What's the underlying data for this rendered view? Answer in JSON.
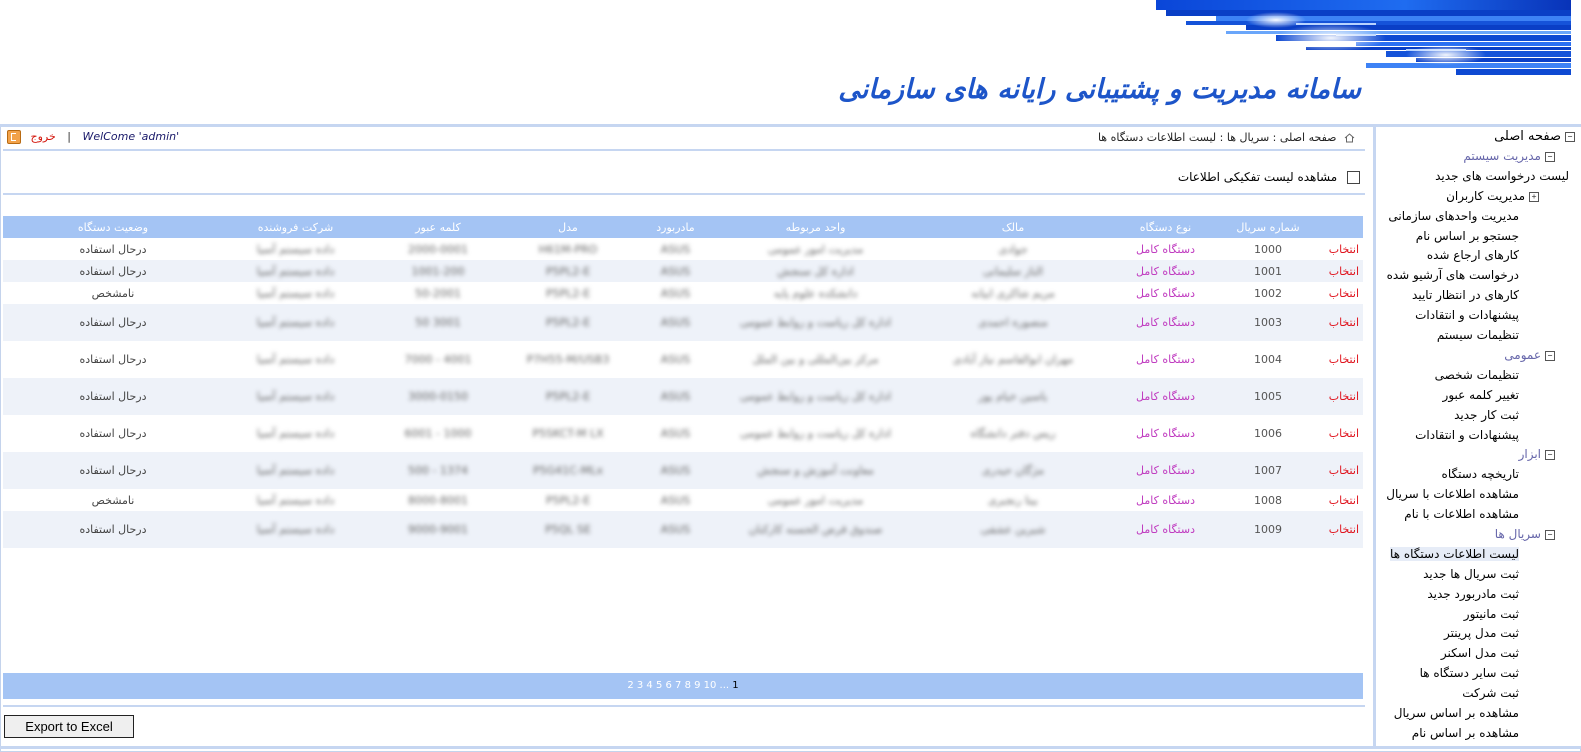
{
  "header": {
    "title": "سامانه مدیریت و پشتیبانی رایانه های سازمانی"
  },
  "topbar": {
    "breadcrumb": "صفحه اصلی : سریال ها : لیست اطلاعات دستگاه ها",
    "exit_label": "خروج",
    "separator": "|",
    "welcome": "WelCome 'admin'"
  },
  "filter": {
    "checkbox_label": "مشاهده لیست تفکیکی اطلاعات"
  },
  "table": {
    "columns": [
      "",
      "شماره سریال",
      "نوع دستگاه",
      "مالک",
      "واحد مربوطه",
      "مادربورد",
      "مدل",
      "کلمه عبور",
      "شرکت فروشنده",
      "وضعیت دستگاه"
    ],
    "rows": [
      {
        "action": "انتخاب",
        "serial": "1000",
        "type": "دستگاه کامل",
        "owner": "جوادی",
        "unit": "مدیریت امور عمومی",
        "mb": "ASUS",
        "model": "H61M-PRO",
        "password": "2000-0001",
        "vendor": "داده سیستم آسیا",
        "status": "درحال استفاده"
      },
      {
        "action": "انتخاب",
        "serial": "1001",
        "type": "دستگاه کامل",
        "owner": "الناز سلیمانی",
        "unit": "اداره کل سنجش",
        "mb": "ASUS",
        "model": "P5PL2-E",
        "password": "1001-200",
        "vendor": "داده سیستم آسیا",
        "status": "درحال استفاده"
      },
      {
        "action": "انتخاب",
        "serial": "1002",
        "type": "دستگاه کامل",
        "owner": "مریم شاکری ابیانه",
        "unit": "دانشکده علوم پایه",
        "mb": "ASUS",
        "model": "P5PL2-E",
        "password": "50-2001",
        "vendor": "داده سیستم آسیا",
        "status": "نامشخص"
      },
      {
        "action": "انتخاب",
        "serial": "1003",
        "type": "دستگاه کامل",
        "owner": "منصوره احمدی",
        "unit": "اداره کل ریاست و روابط عمومی",
        "mb": "ASUS",
        "model": "P5PL2-E",
        "password": "3001 50",
        "vendor": "داده سیستم آسیا",
        "status": "درحال استفاده"
      },
      {
        "action": "انتخاب",
        "serial": "1004",
        "type": "دستگاه کامل",
        "owner": "مهران ابوالقاسم نیاز آبادی",
        "unit": "مرکز بین‌المللی و بین الملل",
        "mb": "ASUS",
        "model": "P7H55-M/USB3",
        "password": "4001 - 7000",
        "vendor": "داده سیستم آسیا",
        "status": "درحال استفاده"
      },
      {
        "action": "انتخاب",
        "serial": "1005",
        "type": "دستگاه کامل",
        "owner": "یاسین خیام پور",
        "unit": "اداره کل ریاست و روابط عمومی",
        "mb": "ASUS",
        "model": "P5PL2-E",
        "password": "3000-0150",
        "vendor": "داده سیستم آسیا",
        "status": "درحال استفاده"
      },
      {
        "action": "انتخاب",
        "serial": "1006",
        "type": "دستگاه کامل",
        "owner": "ریس دفتر دانشگاه",
        "unit": "اداره کل ریاست و روابط عمومی",
        "mb": "ASUS",
        "model": "P5SKCT-M LX",
        "password": "1000 - 6001",
        "vendor": "داده سیستم آسیا",
        "status": "درحال استفاده"
      },
      {
        "action": "انتخاب",
        "serial": "1007",
        "type": "دستگاه کامل",
        "owner": "مژگان حیدری",
        "unit": "معاونت آموزش و سنجش",
        "mb": "ASUS",
        "model": "P5G41C-MLx",
        "password": "1374 - 500",
        "vendor": "داده سیستم آسیا",
        "status": "درحال استفاده"
      },
      {
        "action": "انتخاب",
        "serial": "1008",
        "type": "دستگاه کامل",
        "owner": "بیتا رنجبری",
        "unit": "مدیریت امور عمومی",
        "mb": "ASUS",
        "model": "P5PL2-E",
        "password": "8000-8001",
        "vendor": "داده سیستم آسیا",
        "status": "نامشخص"
      },
      {
        "action": "انتخاب",
        "serial": "1009",
        "type": "دستگاه کامل",
        "owner": "شیرین عشقی",
        "unit": "صندوق قرض الحسنه کارکنان",
        "mb": "ASUS",
        "model": "P5QL SE",
        "password": "9000-9001",
        "vendor": "داده سیستم آسیا",
        "status": "درحال استفاده"
      }
    ]
  },
  "pager": {
    "current": "1",
    "pages": "2 3 4 5 6 7 8 9 10 ..."
  },
  "export_label": "Export to Excel",
  "nav": {
    "root": "صفحه اصلی",
    "groups": [
      {
        "label": "مدیریت سیستم",
        "items": [
          "لیست درخواست های جدید",
          "مدیریت کاربران",
          "مدیریت واحدهای سازمانی",
          "جستجو بر اساس نام",
          "کارهای ارجاع شده",
          "درخواست های آرشیو شده",
          "کارهای در انتظار تایید",
          "پیشنهادات و انتقادات",
          "تنظیمات سیستم"
        ]
      },
      {
        "label": "عمومی",
        "items": [
          "تنظیمات شخصی",
          "تغییر کلمه عبور",
          "ثبت کار جدید",
          "پیشنهادات و انتقادات"
        ]
      },
      {
        "label": "ابزار",
        "items": [
          "تاریخچه دستگاه",
          "مشاهده اطلاعات با سریال",
          "مشاهده اطلاعات با نام"
        ]
      },
      {
        "label": "سریال ها",
        "items": [
          "لیست اطلاعات دستگاه ها",
          "ثبت سریال ها جدید",
          "ثبت مادربورد جدید",
          "ثبت مانیتور",
          "ثبت مدل پرینتر",
          "ثبت مدل اسکنر",
          "ثبت سایر دستگاه ها",
          "ثبت شرکت",
          "مشاهده بر اساس سریال",
          "مشاهده بر اساس نام"
        ]
      }
    ]
  },
  "colors": {
    "title_blue": "#1d55c9",
    "header_blue": "#a4c4f4",
    "select_red": "#e0141e",
    "type_purple": "#c03cc0"
  }
}
